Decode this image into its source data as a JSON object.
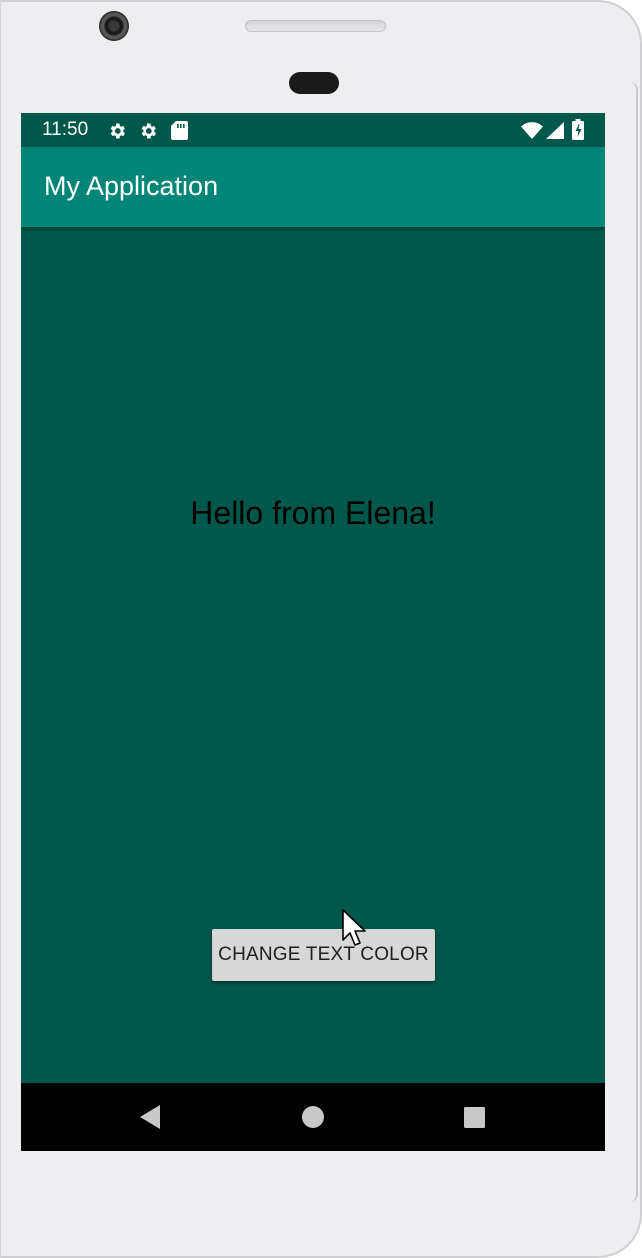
{
  "status_bar": {
    "time": "11:50",
    "left_icons": [
      "settings-gear-icon",
      "settings-gear-icon",
      "sd-card-icon"
    ],
    "right_icons": [
      "wifi-icon",
      "cell-signal-icon",
      "battery-icon"
    ]
  },
  "app_bar": {
    "title": "My Application",
    "color": "#008577"
  },
  "main": {
    "greeting_text": "Hello from Elena!",
    "background_color": "#00574b",
    "text_color": "#000000",
    "button_label": "CHANGE TEXT COLOR"
  },
  "nav_bar": {
    "buttons": [
      "back-icon",
      "home-icon",
      "recents-icon"
    ]
  }
}
